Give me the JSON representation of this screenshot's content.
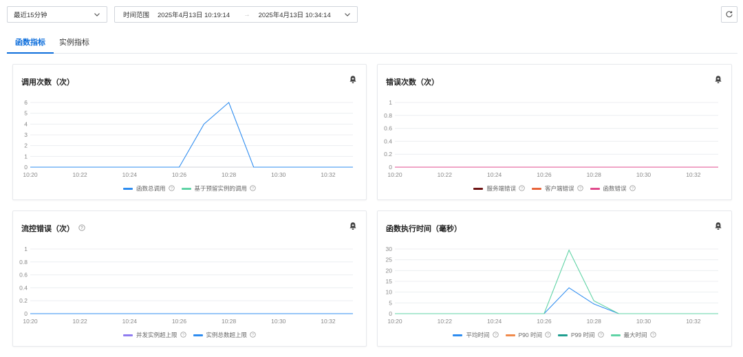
{
  "toolbar": {
    "range_value": "最近15分钟",
    "time_label": "时间范围",
    "time_start": "2025年4月13日 10:19:14",
    "time_sep": "→",
    "time_end": "2025年4月13日 10:34:14"
  },
  "tabs": [
    {
      "label": "函数指标",
      "active": true
    },
    {
      "label": "实例指标",
      "active": false
    }
  ],
  "colors": {
    "accent": "#0a6cdb",
    "invocations_total": "#2d8cf0",
    "reserved_invocations": "#5fd3a5",
    "server_error": "#6e1414",
    "client_error": "#e8643a",
    "function_error": "#e04a8c",
    "concurrency_limit": "#8f7cf0",
    "instance_limit": "#2d8cf0",
    "avg": "#2d8cf0",
    "p90": "#f08a4b",
    "p99": "#1f9e8f",
    "max": "#5fd3a5"
  },
  "chart_data": [
    {
      "id": "c1",
      "type": "line",
      "title": "调用次数（次）",
      "has_help": false,
      "x": [
        "10:20",
        "10:21",
        "10:22",
        "10:23",
        "10:24",
        "10:25",
        "10:26",
        "10:27",
        "10:28",
        "10:29",
        "10:30",
        "10:31",
        "10:32",
        "10:33"
      ],
      "xticks": [
        "10:20",
        "10:22",
        "10:24",
        "10:26",
        "10:28",
        "10:30",
        "10:32"
      ],
      "ylim": [
        0,
        6
      ],
      "yticks": [
        "0",
        "1",
        "2",
        "3",
        "4",
        "5",
        "6"
      ],
      "series": [
        {
          "name": "函数总调用",
          "color": "#2d8cf0",
          "values": [
            0,
            0,
            0,
            0,
            0,
            0,
            0,
            4,
            6,
            0,
            0,
            0,
            0,
            0
          ]
        },
        {
          "name": "基于预留实例的调用",
          "color": "#5fd3a5",
          "values": null
        }
      ]
    },
    {
      "id": "c2",
      "type": "line",
      "title": "错误次数（次）",
      "has_help": false,
      "x": [
        "10:20",
        "10:21",
        "10:22",
        "10:23",
        "10:24",
        "10:25",
        "10:26",
        "10:27",
        "10:28",
        "10:29",
        "10:30",
        "10:31",
        "10:32",
        "10:33"
      ],
      "xticks": [
        "10:20",
        "10:22",
        "10:24",
        "10:26",
        "10:28",
        "10:30",
        "10:32"
      ],
      "ylim": [
        0,
        1
      ],
      "yticks": [
        "0",
        "0.2",
        "0.4",
        "0.6",
        "0.8",
        "1"
      ],
      "series": [
        {
          "name": "服务端错误",
          "color": "#6e1414",
          "values": null
        },
        {
          "name": "客户端错误",
          "color": "#e8643a",
          "values": null
        },
        {
          "name": "函数错误",
          "color": "#e04a8c",
          "values": [
            0,
            0,
            0,
            0,
            0,
            0,
            0,
            0,
            0,
            0,
            0,
            0,
            0,
            0
          ]
        }
      ]
    },
    {
      "id": "c3",
      "type": "line",
      "title": "流控错误（次）",
      "has_help": true,
      "x": [
        "10:20",
        "10:21",
        "10:22",
        "10:23",
        "10:24",
        "10:25",
        "10:26",
        "10:27",
        "10:28",
        "10:29",
        "10:30",
        "10:31",
        "10:32",
        "10:33"
      ],
      "xticks": [
        "10:20",
        "10:22",
        "10:24",
        "10:26",
        "10:28",
        "10:30",
        "10:32"
      ],
      "ylim": [
        0,
        1
      ],
      "yticks": [
        "0",
        "0.2",
        "0.4",
        "0.6",
        "0.8",
        "1"
      ],
      "series": [
        {
          "name": "并发实例超上限",
          "color": "#8f7cf0",
          "values": null
        },
        {
          "name": "实例总数超上限",
          "color": "#2d8cf0",
          "values": [
            0,
            0,
            0,
            0,
            0,
            0,
            0,
            0,
            0,
            0,
            0,
            0,
            0,
            0
          ]
        }
      ]
    },
    {
      "id": "c4",
      "type": "line",
      "title": "函数执行时间（毫秒）",
      "has_help": false,
      "x": [
        "10:20",
        "10:21",
        "10:22",
        "10:23",
        "10:24",
        "10:25",
        "10:26",
        "10:27",
        "10:28",
        "10:29",
        "10:30",
        "10:31",
        "10:32",
        "10:33"
      ],
      "xticks": [
        "10:20",
        "10:22",
        "10:24",
        "10:26",
        "10:28",
        "10:30",
        "10:32"
      ],
      "ylim": [
        0,
        30
      ],
      "yticks": [
        "0",
        "5",
        "10",
        "15",
        "20",
        "25",
        "30"
      ],
      "series": [
        {
          "name": "平均时间",
          "color": "#2d8cf0",
          "values": [
            0,
            0,
            0,
            0,
            0,
            0,
            0,
            12,
            4.5,
            0,
            0,
            0,
            0,
            0
          ]
        },
        {
          "name": "P90 时间",
          "color": "#f08a4b",
          "values": null
        },
        {
          "name": "P99 时间",
          "color": "#1f9e8f",
          "values": null
        },
        {
          "name": "最大时间",
          "color": "#5fd3a5",
          "values": [
            0,
            0,
            0,
            0,
            0,
            0,
            0,
            29.5,
            6,
            0,
            0,
            0,
            0,
            0
          ]
        }
      ]
    }
  ]
}
